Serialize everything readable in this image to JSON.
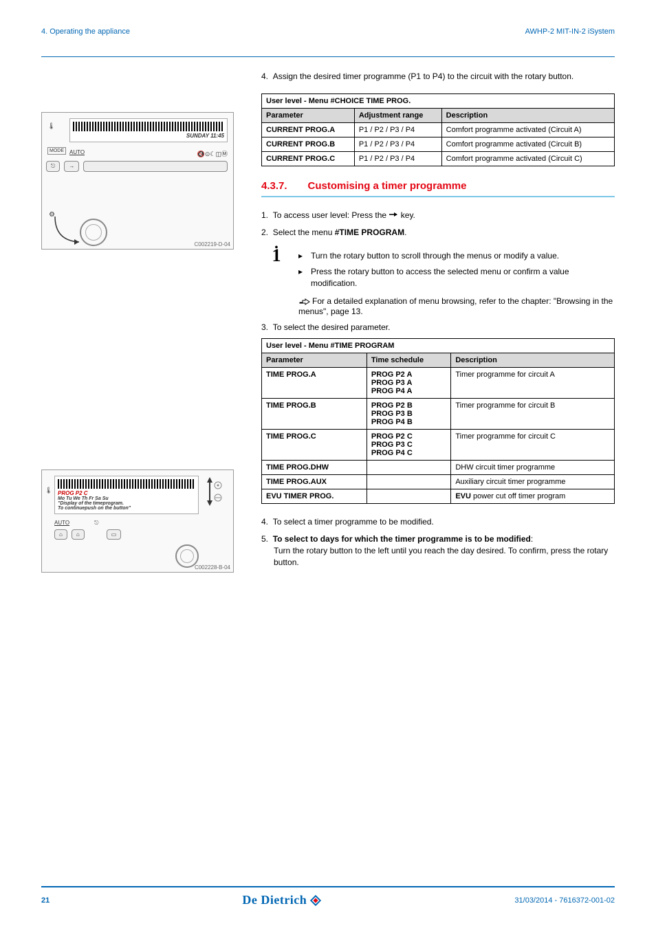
{
  "header": {
    "section": "4.  Operating the appliance",
    "product": "AWHP-2 MIT-IN-2 iSystem"
  },
  "step4_top": "Assign the desired timer programme (P1 to P4) to the circuit with the rotary button.",
  "table1": {
    "title": "User level - Menu #CHOICE TIME PROG.",
    "cols": [
      "Parameter",
      "Adjustment range",
      "Description"
    ],
    "rows": [
      {
        "p": "CURRENT PROG.A",
        "a": "P1 / P2 / P3 / P4",
        "d": "Comfort programme activated (Circuit A)"
      },
      {
        "p": "CURRENT PROG.B",
        "a": "P1 / P2 / P3 / P4",
        "d": "Comfort programme activated (Circuit B)"
      },
      {
        "p": "CURRENT PROG.C",
        "a": "P1 / P2 / P3 / P4",
        "d": "Comfort programme activated (Circuit C)"
      }
    ]
  },
  "section437": {
    "num": "4.3.7.",
    "title": "Customising a timer programme"
  },
  "steps437": {
    "s1_a": "To access user level: Press the ",
    "s1_b": " key.",
    "s2_a": "Select the menu ",
    "s2_b": "#TIME PROGRAM",
    "s2_c": ".",
    "bullet1": "Turn the rotary button to scroll through the menus or modify a value.",
    "bullet2": "Press the rotary button to access the selected menu or confirm a value modification.",
    "note": "For a detailed explanation of menu browsing, refer to the chapter:  \"Browsing in the menus\", page 13.",
    "s3": "To select the desired parameter."
  },
  "table2": {
    "title": "User level - Menu #TIME PROGRAM",
    "cols": [
      "Parameter",
      "Time schedule",
      "Description"
    ],
    "rows": [
      {
        "p": "TIME PROG.A",
        "t": "PROG P2 A\nPROG P3 A\nPROG P4 A",
        "d": "Timer programme  for circuit A"
      },
      {
        "p": "TIME PROG.B",
        "t": "PROG P2 B\nPROG P3 B\nPROG P4 B",
        "d": "Timer programme  for circuit B"
      },
      {
        "p": "TIME PROG.C",
        "t": "PROG P2 C\nPROG P3 C\nPROG P4 C",
        "d": "Timer programme  for circuit C"
      },
      {
        "p": "TIME PROG.DHW",
        "t": "",
        "d": "DHW circuit timer programme"
      },
      {
        "p": "TIME PROG.AUX",
        "t": "",
        "d": "Auxiliary circuit timer programme"
      },
      {
        "p": "EVU TIMER PROG.",
        "t": "",
        "d_bold": "EVU",
        "d_rest": " power cut off timer program"
      }
    ]
  },
  "steps_bottom": {
    "s4": "To select a timer programme to be modified.",
    "s5_bold": "To select to days for which the timer programme is to be modified",
    "s5_colon": ":",
    "s5_body": "Turn the rotary button to the left until you reach the day desired. To confirm, press the rotary button."
  },
  "diagram1": {
    "time": "SUNDAY 11:45",
    "mode": "MODE",
    "auto": "AUTO",
    "code": "C002219-D-04"
  },
  "diagram2": {
    "line1": "PROG P2 C",
    "line2": "Mo   Tu   We   Th   Fr   Sa   Su",
    "line3": "\"Display of the timeprogram.",
    "line4": "To continuepush on the button\"",
    "auto": "AUTO",
    "code": "C002228-B-04"
  },
  "footer": {
    "page": "21",
    "docid": "31/03/2014 - 7616372-001-02",
    "brand": "De Dietrich"
  }
}
